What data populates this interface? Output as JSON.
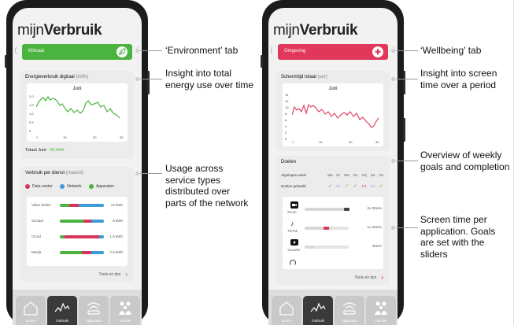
{
  "left_phone": {
    "title_light": "mijn",
    "title_bold": "Verbruik",
    "tab_label": "Klimaat",
    "tab_icon": "leaf-icon",
    "energy_card": {
      "title": "Energieverbruik digitaal",
      "unit": "(kWh)",
      "chart_month": "Juni",
      "y_ticks": [
        "2.0",
        "1.5",
        "1.0",
        "0.5",
        "0"
      ],
      "x_ticks": [
        "1",
        "10",
        "20",
        "30"
      ],
      "total_label": "Totaal Juni:",
      "total_value": "45 kWh"
    },
    "service_card": {
      "title": "Verbruik per dienst",
      "unit": "(maand)",
      "legend": [
        {
          "label": "Data center",
          "color": "#d6345a"
        },
        {
          "label": "Netwerk",
          "color": "#3d9ad8"
        },
        {
          "label": "Apparaten",
          "color": "#4bb33f"
        }
      ],
      "rows": [
        {
          "label": "Video bellen",
          "value": "14 kWh"
        },
        {
          "label": "Sociaal",
          "value": "8 kWh"
        },
        {
          "label": "Cloud",
          "value": "1.5 kWh"
        },
        {
          "label": "Media",
          "value": "7.6 kWh"
        }
      ],
      "tips": "Tools en tips"
    }
  },
  "right_phone": {
    "title_light": "mijn",
    "title_bold": "Verbruik",
    "tab_label": "Omgeving",
    "tab_icon": "plus-icon",
    "screen_card": {
      "title": "Schermtijd totaal",
      "unit": "(uur)",
      "chart_month": "Juni",
      "y_ticks": [
        "14",
        "12",
        "10",
        "8",
        "6",
        "4",
        "2",
        "0"
      ],
      "x_ticks": [
        "1",
        "10",
        "20",
        "30"
      ]
    },
    "goals_card": {
      "title": "Doelen",
      "row1_label": "Afgelopen week",
      "days": [
        "Ma",
        "Di",
        "We",
        "Do",
        "Vrij",
        "Za",
        "Zo"
      ],
      "row2_label": "Doelen gehaald",
      "checks": [
        "✓",
        "3/4",
        "✓",
        "✓",
        "1/4",
        "3/4",
        "✓"
      ],
      "apps": [
        {
          "name": "Zoom",
          "time": "2u 35min",
          "icon": "video-camera-icon"
        },
        {
          "name": "TikTok",
          "time": "1u 25min",
          "icon": "tiktok-icon"
        },
        {
          "name": "Youtube",
          "time": "45min",
          "icon": "youtube-icon"
        }
      ],
      "tips": "Tools en tips"
    }
  },
  "nav": [
    {
      "label": "Home",
      "icon": "home-icon"
    },
    {
      "label": "Gebruik",
      "icon": "activity-icon"
    },
    {
      "label": "Apparaten",
      "icon": "wifi-icon"
    },
    {
      "label": "Familie",
      "icon": "family-icon"
    }
  ],
  "callouts": {
    "environment_tab": "‘Environment’ tab",
    "energy": "Insight into total energy use over time",
    "usage": "Usage across service types distributed over parts of the network",
    "wellbeing_tab": "‘Wellbeing’ tab",
    "screen_time": "Insight into screen time over a period",
    "weekly_goals": "Overview of weekly goals and completion",
    "per_app": "Screen time per application. Goals are set with the sliders"
  },
  "colors": {
    "green": "#4bb33f",
    "red": "#e0375a",
    "blue": "#3d9ad8"
  }
}
